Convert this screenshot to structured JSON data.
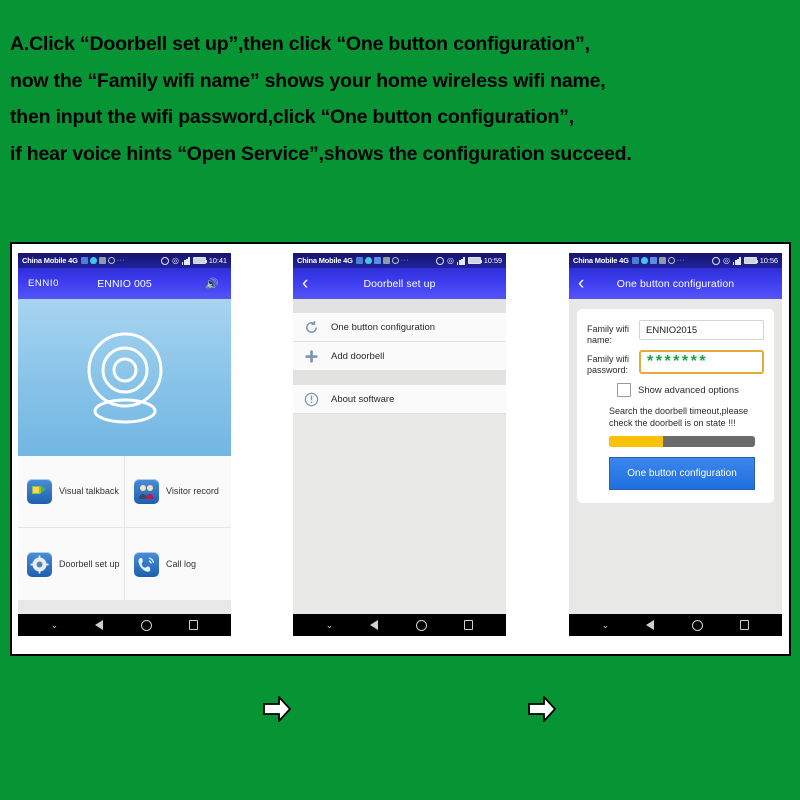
{
  "page": {
    "background_color": "#079434",
    "instructions": "A.Click “Doorbell set up”,then click “One button configuration”,\nnow the “Family wifi name” shows your home wireless wifi name,\nthen input the wifi password,click “One button configuration”,\nif hear voice hints “Open Service”,shows the configuration succeed."
  },
  "flow": {
    "arrow_1": "right-arrow",
    "arrow_2": "right-arrow"
  },
  "phone1": {
    "status_bar": {
      "carrier": "China Mobile 4G",
      "time": "10:41",
      "dots": "···"
    },
    "app_bar": {
      "left_label": "ENNI0",
      "title": "ENNIO 005",
      "right_icon": "speaker-icon"
    },
    "camera_placeholder": "camera-outline-icon",
    "grid": [
      {
        "label": "Visual talkback",
        "icon": "visual-talkback-icon"
      },
      {
        "label": "Visitor record",
        "icon": "visitor-record-icon"
      },
      {
        "label": "Doorbell set up",
        "icon": "gear-icon"
      },
      {
        "label": "Call log",
        "icon": "phone-icon"
      }
    ],
    "nav": {
      "chevron": "⌄",
      "back": "back-triangle",
      "home": "home-circle",
      "recents": "recents-square"
    }
  },
  "phone2": {
    "status_bar": {
      "carrier": "China Mobile 4G",
      "time": "10:59",
      "dots": "···"
    },
    "app_bar": {
      "back": "‹",
      "title": "Doorbell set up"
    },
    "list": [
      {
        "label": "One button configuration",
        "icon": "refresh-icon"
      },
      {
        "label": "Add doorbell",
        "icon": "plus-icon"
      },
      {
        "label": "About software",
        "icon": "info-icon"
      }
    ],
    "nav": {
      "chevron": "⌄",
      "back": "back-triangle",
      "home": "home-circle",
      "recents": "recents-square"
    }
  },
  "phone3": {
    "status_bar": {
      "carrier": "China Mobile 4G",
      "time": "10:56",
      "dots": "···"
    },
    "app_bar": {
      "back": "‹",
      "title": "One button configuration"
    },
    "form": {
      "wifi_name_label": "Family wifi name:",
      "wifi_name_value": "ENNIO2015",
      "wifi_name_placeholder": "Family wifi name",
      "wifi_password_label": "Family wifi password:",
      "wifi_password_masked": "*******",
      "wifi_password_placeholder": "Family wifi password",
      "advanced_checkbox_label": "Show advanced options",
      "advanced_checked": false,
      "hint": "Search the doorbell timeout,please check the doorbell is on state !!!",
      "progress_percent": 37,
      "progress_fill_color": "#fac109",
      "progress_track_color": "#6b6b6b",
      "submit_label": "One button configuration"
    },
    "nav": {
      "chevron": "⌄",
      "back": "back-triangle",
      "home": "home-circle",
      "recents": "recents-square"
    }
  }
}
